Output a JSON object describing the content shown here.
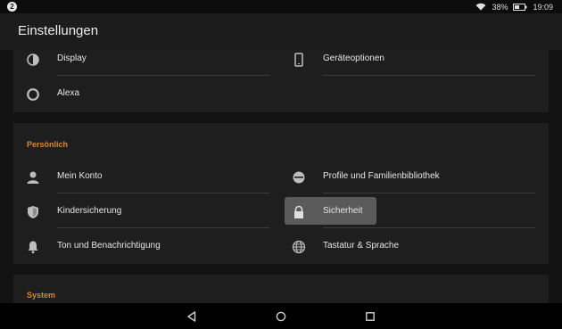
{
  "status": {
    "notification_count": "2",
    "battery_percent": "38%",
    "time": "19:09"
  },
  "header": {
    "title": "Einstellungen"
  },
  "groups": [
    {
      "title": "",
      "items": [
        {
          "label": "Display",
          "icon": "display-icon"
        },
        {
          "label": "Geräteoptionen",
          "icon": "device-icon"
        },
        {
          "label": "Alexa",
          "icon": "alexa-icon"
        }
      ]
    },
    {
      "title": "Persönlich",
      "items": [
        {
          "label": "Mein Konto",
          "icon": "account-icon"
        },
        {
          "label": "Profile und Familienbibliothek",
          "icon": "profiles-icon"
        },
        {
          "label": "Kindersicherung",
          "icon": "shield-icon"
        },
        {
          "label": "Sicherheit",
          "icon": "lock-icon",
          "selected": true
        },
        {
          "label": "Ton und Benachrichtigung",
          "icon": "bell-icon"
        },
        {
          "label": "Tastatur & Sprache",
          "icon": "globe-icon"
        }
      ]
    },
    {
      "title": "System",
      "items": []
    }
  ],
  "colors": {
    "accent": "#d9892d",
    "background": "#121212",
    "card": "#1e1e1e",
    "selected": "#5a5a5a"
  }
}
